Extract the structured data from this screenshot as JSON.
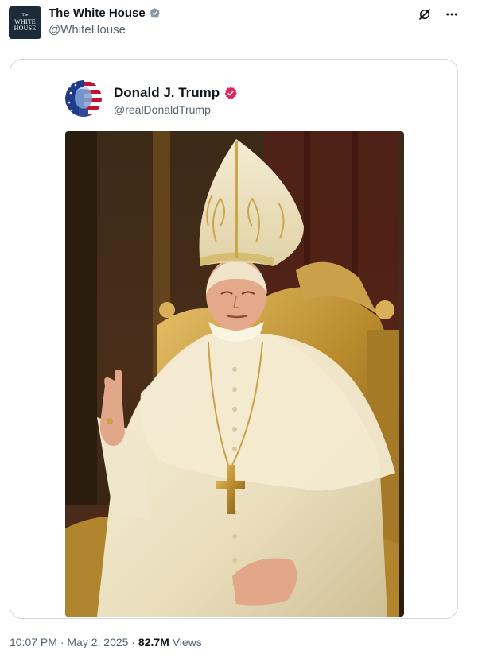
{
  "post": {
    "author_name": "The White House",
    "author_handle": "@WhiteHouse",
    "avatar_text_small": "The",
    "avatar_text_line1": "WHITE",
    "avatar_text_line2": "HOUSE"
  },
  "quoted": {
    "author_name": "Donald J. Trump",
    "author_handle": "@realDonaldTrump"
  },
  "footer": {
    "time": "10:07 PM",
    "separator1": " · ",
    "date": "May 2, 2025",
    "separator2": " · ",
    "views_count": "82.7M",
    "views_label": " Views"
  },
  "icons": {
    "verified_gray": "verified-badge-gray-icon",
    "verified_pink": "verified-badge-pink-icon",
    "grok": "grok-icon",
    "more": "more-icon"
  },
  "colors": {
    "text": "#0f1419",
    "muted": "#536471",
    "border": "#cfd9de",
    "verified_gray": "#829aab",
    "verified_pink": "#e0245e"
  }
}
